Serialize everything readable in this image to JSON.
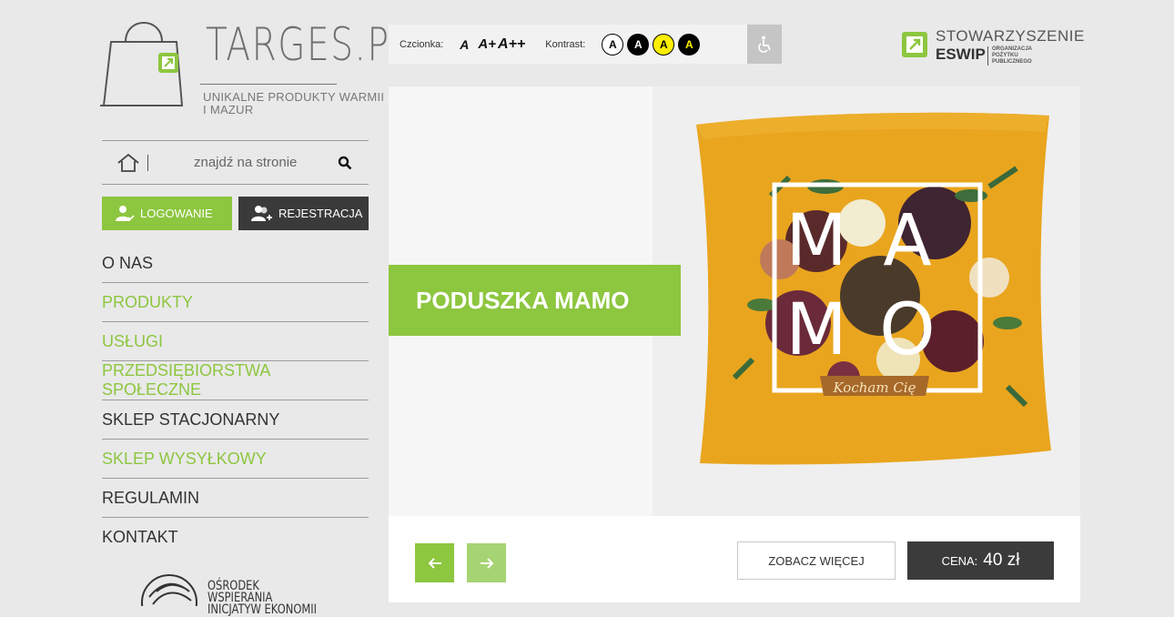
{
  "brand": {
    "name": "TARGES.PL",
    "tagline": "UNIKALNE PRODUKTY WARMII I MAZUR"
  },
  "search": {
    "placeholder": "znajdź na stronie"
  },
  "auth": {
    "login_label": "LOGOWANIE",
    "register_label": "REJESTRACJA"
  },
  "menu": {
    "items": [
      {
        "label": "O NAS",
        "color": "#333333"
      },
      {
        "label": "PRODUKTY",
        "color": "#8dc63f"
      },
      {
        "label": "USŁUGI",
        "color": "#8dc63f"
      },
      {
        "label": "PRZEDSIĘBIORSTWA SPOŁECZNE",
        "color": "#8dc63f"
      },
      {
        "label": "SKLEP STACJONARNY",
        "color": "#333333"
      },
      {
        "label": "SKLEP WYSYŁKOWY",
        "color": "#8dc63f"
      },
      {
        "label": "REGULAMIN",
        "color": "#333333"
      },
      {
        "label": "KONTAKT",
        "color": "#333333"
      }
    ]
  },
  "footer_logo": {
    "text": "OŚRODEK WSPIERANIA INICJATYW EKONOMII"
  },
  "toolbar": {
    "font_label": "Czcionka:",
    "font_sizes": [
      "A",
      "A+",
      "A++"
    ],
    "contrast_label": "Kontrast:",
    "contrast_options": [
      "A",
      "A",
      "A",
      "A"
    ]
  },
  "org": {
    "title_line1": "STOWARZYSZENIE",
    "title_line2": "ESWIP",
    "subtitle": "ORGANIZACJA POŻYTKU PUBLICZNEGO"
  },
  "banner": {
    "title": "PODUSZKA MAMO",
    "pillow_text": [
      "M",
      "A",
      "M",
      "O"
    ],
    "pillow_ribbon": "Kocham Cię",
    "more_label": "ZOBACZ WIĘCEJ",
    "price_label": "CENA:",
    "price_value": "40 zł"
  },
  "colors": {
    "accent": "#8dc63f",
    "dark": "#3b3b3b",
    "pillow": "#e9a51e"
  }
}
